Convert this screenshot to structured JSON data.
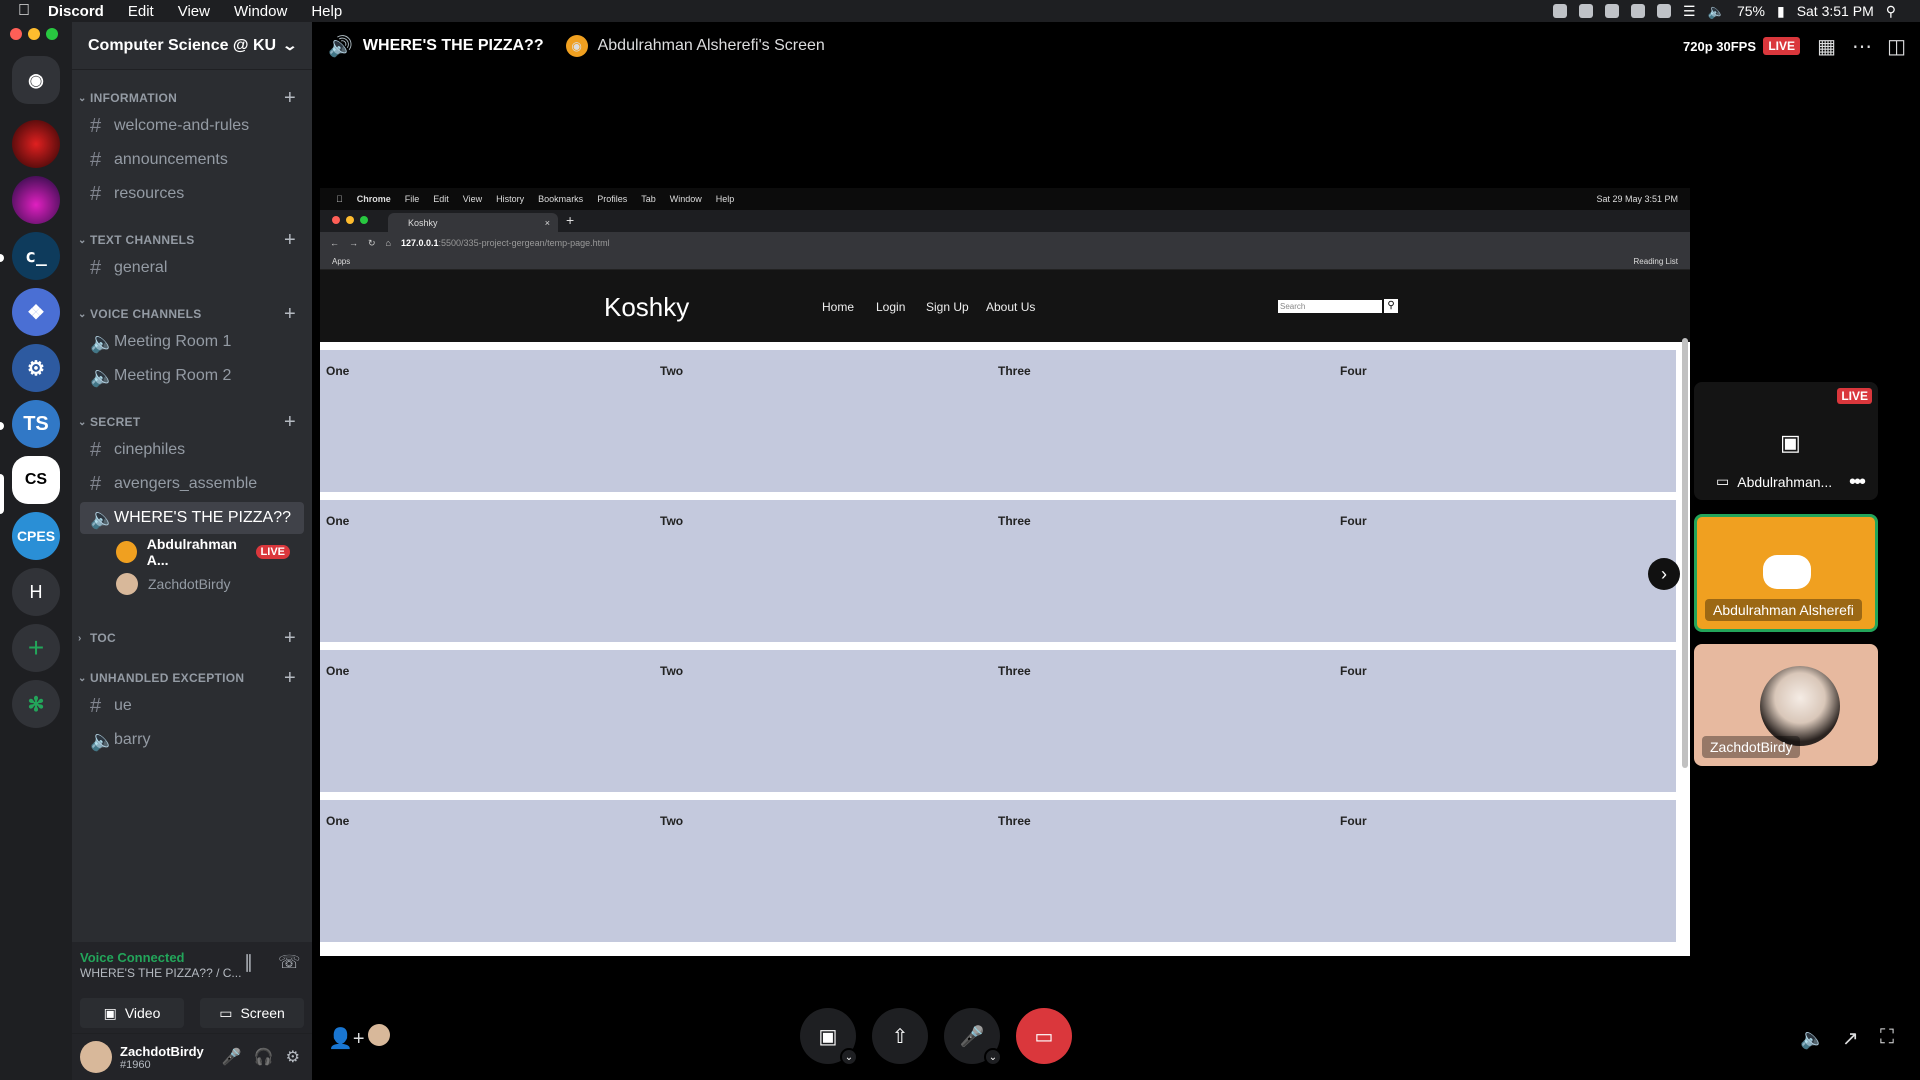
{
  "menubar": {
    "app": "Discord",
    "items": [
      "Edit",
      "View",
      "Window",
      "Help"
    ],
    "battery": "75%",
    "clock": "Sat 3:51 PM"
  },
  "guild": {
    "name": "Computer Science @ KU"
  },
  "servers": [
    {
      "label": "",
      "color": "#5865f2"
    },
    {
      "label": "",
      "color": "#8b1a1a"
    },
    {
      "label": "",
      "color": "#3a1a6e"
    },
    {
      "label": "c_",
      "color": "#0e3b5c"
    },
    {
      "label": "",
      "color": "#4a6fd4"
    },
    {
      "label": "",
      "color": "#2d5aa0"
    },
    {
      "label": "TS",
      "color": "#3178c6"
    },
    {
      "label": "CS",
      "color": "#ffffff"
    },
    {
      "label": "CPES",
      "color": "#2a8fd6"
    },
    {
      "label": "H",
      "color": "#313338"
    },
    {
      "label": "+",
      "color": "#313338"
    },
    {
      "label": "",
      "color": "#313338"
    }
  ],
  "categories": {
    "information": "INFORMATION",
    "text_channels": "TEXT CHANNELS",
    "voice_channels": "VOICE CHANNELS",
    "secret": "SECRET",
    "toc": "TOC",
    "unhandled": "UNHANDLED EXCEPTION"
  },
  "channels": {
    "welcome": "welcome-and-rules",
    "announcements": "announcements",
    "resources": "resources",
    "general": "general",
    "meeting1": "Meeting Room 1",
    "meeting2": "Meeting Room 2",
    "cinephiles": "cinephiles",
    "avengers": "avengers_assemble",
    "pizza": "WHERE'S THE PIZZA??",
    "ue": "ue",
    "barry": "barry"
  },
  "voice_users": [
    {
      "name": "Abdulrahman A...",
      "badge": "LIVE"
    },
    {
      "name": "ZachdotBirdy"
    }
  ],
  "voice_panel": {
    "status": "Voice Connected",
    "sub": "WHERE'S THE PIZZA?? / C...",
    "video": "Video",
    "screen": "Screen"
  },
  "user": {
    "name": "ZachdotBirdy",
    "tag": "#1960"
  },
  "stage": {
    "channel": "WHERE'S THE PIZZA??",
    "stream_name": "Abdulrahman Alsherefi's Screen",
    "quality": "720p 30FPS",
    "live": "LIVE"
  },
  "shared_screen": {
    "mac_menu": [
      "Chrome",
      "File",
      "Edit",
      "View",
      "History",
      "Bookmarks",
      "Profiles",
      "Tab",
      "Window",
      "Help"
    ],
    "mac_clock": "Sat 29 May  3:51 PM",
    "tab_title": "Koshky",
    "url_host": "127.0.0.1",
    "url_path": ":5500/335-project-gergean/temp-page.html",
    "bookmark_apps": "Apps",
    "reading_list": "Reading List",
    "site_logo": "Koshky",
    "nav": [
      "Home",
      "Login",
      "Sign Up",
      "About Us"
    ],
    "search_placeholder": "Search",
    "rows": [
      [
        "One",
        "Two",
        "Three",
        "Four"
      ],
      [
        "One",
        "Two",
        "Three",
        "Four"
      ],
      [
        "One",
        "Two",
        "Three",
        "Four"
      ],
      [
        "One",
        "Two",
        "Three",
        "Four"
      ]
    ]
  },
  "participants": {
    "live_tile": {
      "name": "Abdulrahman...",
      "badge": "LIVE"
    },
    "speaker_tile": {
      "name": "Abdulrahman Alsherefi"
    },
    "user_tile": {
      "name": "ZachdotBirdy"
    }
  },
  "icons": {
    "apple": "apple-icon",
    "discord_home": "discord-icon",
    "hash": "hash-icon",
    "speaker": "speaker-icon",
    "camera": "camera-icon",
    "screen_share": "screen-share-icon",
    "mic": "microphone-icon",
    "end_stream": "end-stream-icon"
  },
  "colors": {
    "live_red": "#da373c",
    "voice_green": "#23a55a",
    "orange_tile": "#f0a020",
    "row_fill": "#c4c9dd"
  }
}
